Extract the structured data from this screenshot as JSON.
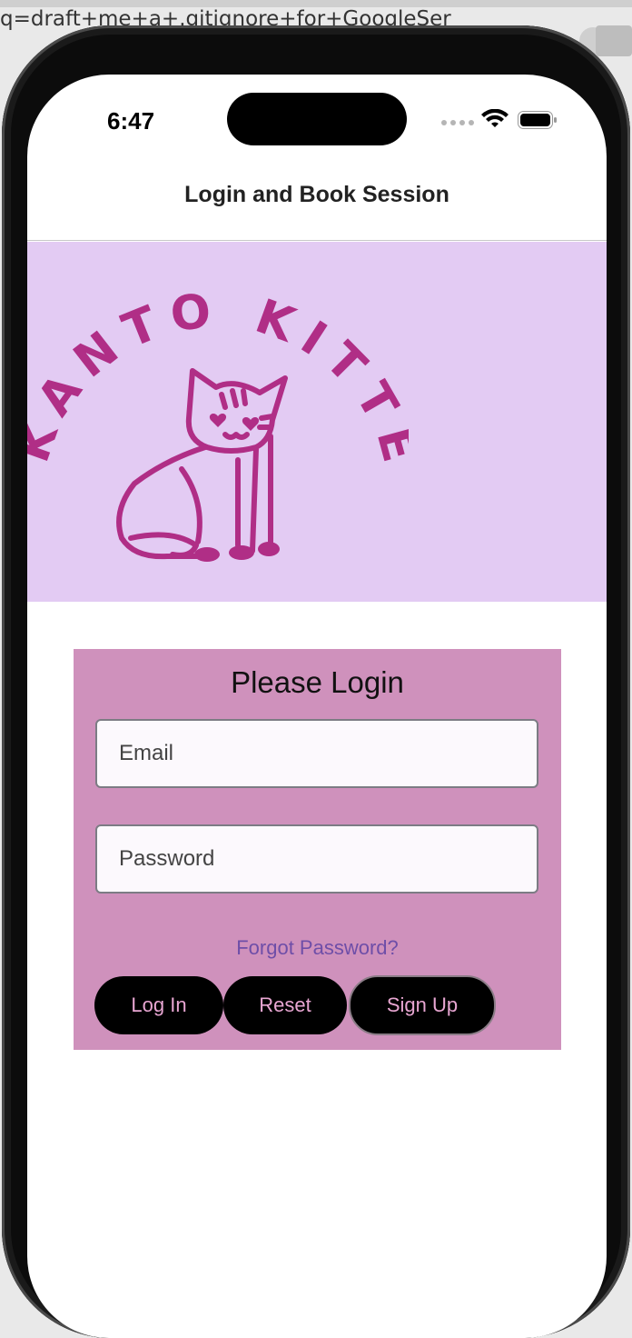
{
  "browser": {
    "url_fragment": "q=draft+me+a+.gitignore+for+GoogleSer"
  },
  "status_bar": {
    "time": "6:47"
  },
  "nav": {
    "title": "Login and Book Session"
  },
  "logo": {
    "text": "KANTO KITTENS"
  },
  "login": {
    "title": "Please Login",
    "email_placeholder": "Email",
    "password_placeholder": "Password",
    "forgot_label": "Forgot Password?",
    "login_label": "Log In",
    "reset_label": "Reset",
    "signup_label": "Sign Up"
  },
  "colors": {
    "hero_bg": "#e3cbf3",
    "card_bg": "#cf91bc",
    "logo_color": "#b02e86",
    "button_bg": "#000000",
    "button_text": "#e8a6d2",
    "link_color": "#6e4ea8"
  }
}
